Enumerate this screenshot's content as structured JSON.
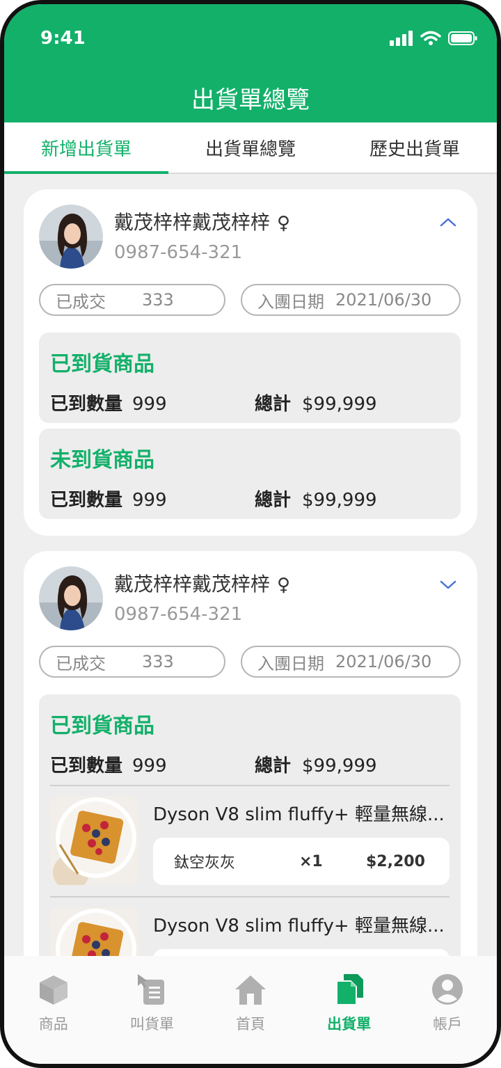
{
  "status_bar": {
    "time": "9:41"
  },
  "header": {
    "title": "出貨單總覽"
  },
  "tabs": [
    {
      "label": "新增出貨單",
      "active": true
    },
    {
      "label": "出貨單總覽",
      "active": false
    },
    {
      "label": "歷史出貨單",
      "active": false
    }
  ],
  "orders": [
    {
      "name": "戴茂梓梓戴茂梓梓",
      "gender": "♀",
      "phone": "0987-654-321",
      "expanded": true,
      "deal_label": "已成交",
      "deal_count": "333",
      "join_label": "入團日期",
      "join_date": "2021/06/30",
      "arrived": {
        "title": "已到貨商品",
        "qty_label": "已到數量",
        "qty": "999",
        "total_label": "總計",
        "total": "$99,999"
      },
      "not_arrived": {
        "title": "未到貨商品",
        "qty_label": "已到數量",
        "qty": "999",
        "total_label": "總計",
        "total": "$99,999"
      }
    },
    {
      "name": "戴茂梓梓戴茂梓梓",
      "gender": "♀",
      "phone": "0987-654-321",
      "expanded": false,
      "deal_label": "已成交",
      "deal_count": "333",
      "join_label": "入團日期",
      "join_date": "2021/06/30",
      "arrived": {
        "title": "已到貨商品",
        "qty_label": "已到數量",
        "qty": "999",
        "total_label": "總計",
        "total": "$99,999"
      },
      "products": [
        {
          "name": "Dyson V8 slim fluffy+ 輕量無線...",
          "variant": "鈦空灰灰",
          "qty": "×1",
          "price": "$2,200"
        },
        {
          "name": "Dyson V8 slim fluffy+ 輕量無線..."
        }
      ]
    }
  ],
  "bottom_nav": [
    {
      "label": "商品",
      "icon": "box-icon"
    },
    {
      "label": "叫貨單",
      "icon": "order-list-icon"
    },
    {
      "label": "首頁",
      "icon": "home-icon"
    },
    {
      "label": "出貨單",
      "icon": "documents-icon",
      "active": true
    },
    {
      "label": "帳戶",
      "icon": "account-icon"
    }
  ],
  "colors": {
    "brand": "#13b06a",
    "accent_chevron": "#4a72d8"
  }
}
